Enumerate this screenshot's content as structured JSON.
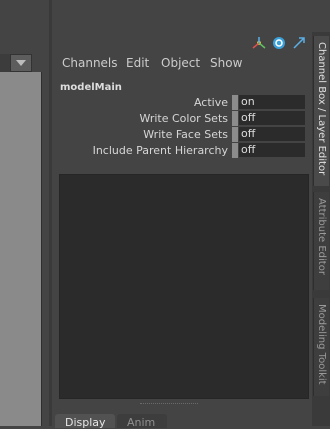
{
  "menubar": {
    "items": [
      "Channels",
      "Edit",
      "Object",
      "Show"
    ]
  },
  "channel_box": {
    "node_name": "modelMain",
    "attributes": [
      {
        "label": "Active",
        "value": "on"
      },
      {
        "label": "Write Color Sets",
        "value": "off"
      },
      {
        "label": "Write Face Sets",
        "value": "off"
      },
      {
        "label": "Include Parent Hierarchy",
        "value": "off"
      }
    ]
  },
  "bottom_tabs": [
    "Display",
    "Anim"
  ],
  "side_tabs": [
    "Channel Box / Layer Editor",
    "Attribute Editor",
    "Modeling Toolkit"
  ],
  "icons": [
    "move-tool-icon",
    "refresh-icon",
    "arrow-diagonal-icon"
  ],
  "colors": {
    "panel_bg": "#444444",
    "field_bg": "#2b2b2b",
    "viewport_bg": "#8a8a8a"
  }
}
